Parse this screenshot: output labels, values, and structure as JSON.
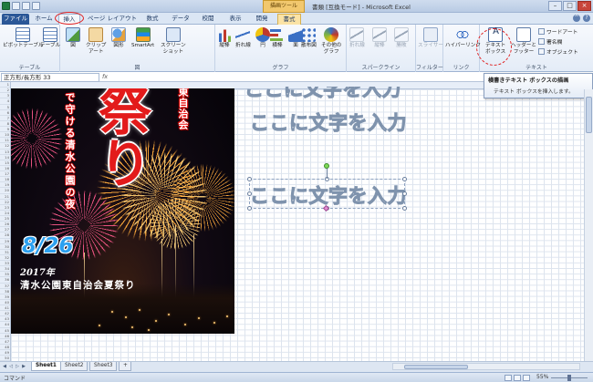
{
  "titlebar": {
    "contextual_tab": "描画ツール",
    "window_title": "書類 [互換モード] - Microsoft Excel",
    "controls": [
      "–",
      "□",
      "×"
    ]
  },
  "tabs": {
    "file": "ファイル",
    "home": "ホーム",
    "insert": "挿入",
    "page_layout": "ページ レイアウト",
    "formulas": "数式",
    "data": "データ",
    "review": "校閲",
    "view": "表示",
    "developer": "開発",
    "format": "書式"
  },
  "ribbon": {
    "tables": {
      "label": "テーブル",
      "pivot": "ピボットテーブル",
      "table": "テーブル"
    },
    "illustrations": {
      "label": "図",
      "picture": "図",
      "clipart": "クリップ\nアート",
      "shapes": "図形",
      "smartart": "SmartArt",
      "screenshot": "スクリーン\nショット"
    },
    "charts": {
      "label": "グラフ",
      "column": "縦棒",
      "line": "折れ線",
      "pie": "円",
      "bar": "横棒",
      "area": "面",
      "scatter": "散布図",
      "other": "その他の\nグラフ"
    },
    "sparklines": {
      "label": "スパークライン",
      "line": "折れ線",
      "column": "縦棒",
      "winloss": "勝敗"
    },
    "filter": {
      "label": "フィルター",
      "slicer": "スライサー"
    },
    "links": {
      "label": "リンク",
      "hyperlink": "ハイパーリンク"
    },
    "text": {
      "label": "テキスト",
      "textbox": "テキスト\nボックス",
      "header_footer": "ヘッダーと\nフッター",
      "wordart": "ワードアート",
      "signature": "署名欄",
      "object": "オブジェクト"
    }
  },
  "tooltip": {
    "title": "横書きテキスト ボックスの描画",
    "description": "テキスト ボックスを挿入します。"
  },
  "formula_bar": {
    "name_box": "正方形/長方形 33",
    "fx": "fx"
  },
  "poster": {
    "top_text": "東自治会",
    "sub_text": "で守ける清水公園の夜",
    "title": "祭り",
    "date": "8/26",
    "year": "2017年",
    "event": "清水公園東自治会夏祭り"
  },
  "wordart": {
    "placeholder": "ここに文字を入力"
  },
  "sheets": [
    "Sheet1",
    "Sheet2",
    "Sheet3"
  ],
  "status": {
    "mode": "コマンド",
    "zoom": "55%"
  }
}
